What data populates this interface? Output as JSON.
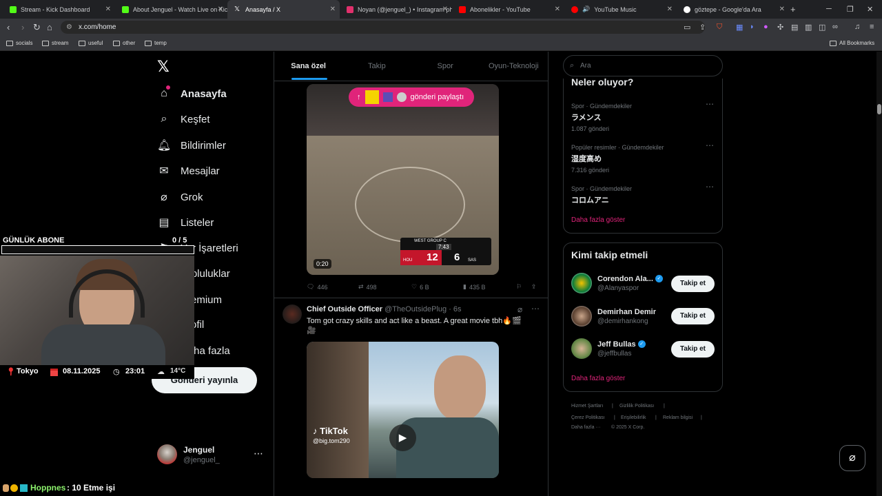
{
  "browser": {
    "tabs": [
      {
        "label": "Stream - Kick Dashboard",
        "color": "#53fc18"
      },
      {
        "label": "About Jenguel - Watch Live on Kick",
        "color": "#53fc18"
      },
      {
        "label": "Anasayfa / X",
        "color": "#ffffff"
      },
      {
        "label": "Noyan (@jenguel_) • Instagram phot",
        "color": "#e1306c"
      },
      {
        "label": "Abonelikler - YouTube",
        "color": "#ff0000"
      },
      {
        "label": "YouTube Music",
        "color": "#ff0000"
      },
      {
        "label": "göztepe - Google'da Ara",
        "color": "#4285f4"
      }
    ],
    "url": "x.com/home",
    "bookmarks": [
      "socials",
      "stream",
      "useful",
      "other",
      "temp"
    ],
    "all_bookmarks": "All Bookmarks"
  },
  "nav": {
    "items": [
      "Anasayfa",
      "Keşfet",
      "Bildirimler",
      "Mesajlar",
      "Grok",
      "Listeler",
      "Yer İşaretleri",
      "Topluluklar",
      "Premium",
      "Profil",
      "Daha fazla"
    ],
    "post_button": "Gönderi yayınla",
    "profile_name": "Jenguel",
    "profile_handle": "@jenguel_"
  },
  "feed": {
    "tabs": [
      "Sana özel",
      "Takip",
      "Spor",
      "Oyun-Teknoloji"
    ],
    "share_label": "gönderi paylaştı",
    "video1": {
      "duration": "0:20",
      "score_home": "12",
      "score_away": "6",
      "team_home": "HOU",
      "team_away": "SAS",
      "clock": "7:43",
      "group": "WEST GROUP C"
    },
    "actions1": {
      "replies": "446",
      "reposts": "498",
      "likes": "6 B",
      "views": "435 B"
    },
    "tweet2": {
      "name": "Chief Outside Officer",
      "handle": "@TheOutsidePlug",
      "time": "· 6s",
      "text": "Tom got crazy skills and act like a beast. A great movie tbh🔥🎬",
      "text2": "🎥",
      "tiktok": "TikTok",
      "tiktok_user": "@big.tom290"
    }
  },
  "right": {
    "search_placeholder": "Ara",
    "whats_happening": "Neler oluyor?",
    "trends": [
      {
        "context": "Spor · Gündemdekiler",
        "title": "ラメンス",
        "count": "1.087 gönderi"
      },
      {
        "context": "Popüler resimler · Gündemdekiler",
        "title": "湿度高め",
        "count": "7.316 gönderi"
      },
      {
        "context": "Spor · Gündemdekiler",
        "title": "コロムアニ",
        "count": ""
      }
    ],
    "show_more": "Daha fazla göster",
    "who_to_follow": "Kimi takip etmeli",
    "suggestions": [
      {
        "name": "Corendon Ala...",
        "handle": "@Alanyaspor",
        "verified": true
      },
      {
        "name": "Demirhan Demir",
        "handle": "@demirhankong",
        "verified": false
      },
      {
        "name": "Jeff Bullas",
        "handle": "@jeffbullas",
        "verified": true
      }
    ],
    "follow_label": "Takip et",
    "footer": [
      "Hizmet Şartları",
      "Gizlilik Politikası",
      "Çerez Politikası",
      "Erişilebilirlik",
      "Reklam bilgisi",
      "Daha fazla ···",
      "© 2025 X Corp."
    ]
  },
  "overlay": {
    "abone_label": "GÜNLÜK ABONE",
    "abone_count": "0 / 5",
    "abone_progress": 0,
    "city": "Tokyo",
    "date": "08.11.2025",
    "time": "23:01",
    "temp": "14°C",
    "ticker_name": "Hoppnes",
    "ticker_text": ": 10 Etme işi"
  },
  "colors": {
    "accent_pink": "#e0247a",
    "x_blue": "#1d9bf0",
    "follow_bg": "#eff3f4"
  }
}
